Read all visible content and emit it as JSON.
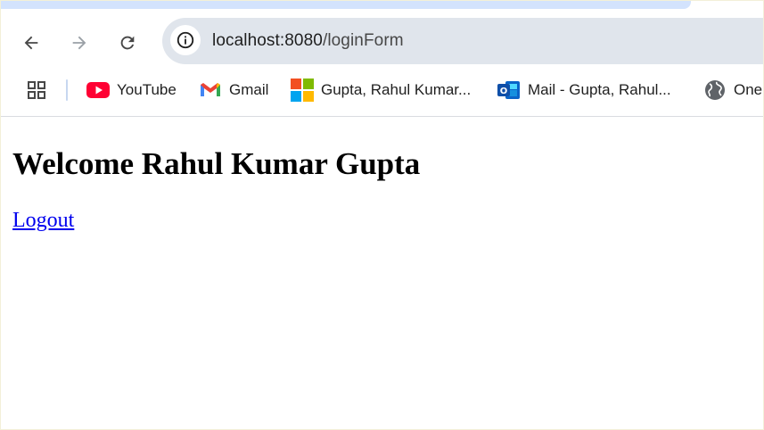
{
  "browser": {
    "address_bar": {
      "host": "localhost:8080",
      "path": "/loginForm"
    },
    "bookmarks": [
      {
        "label": "YouTube",
        "icon": "youtube-icon"
      },
      {
        "label": "Gmail",
        "icon": "gmail-icon"
      },
      {
        "label": "Gupta, Rahul Kumar...",
        "icon": "microsoft-icon"
      },
      {
        "label": "Mail - Gupta, Rahul...",
        "icon": "outlook-icon"
      },
      {
        "label": "One",
        "icon": "globe-icon"
      }
    ],
    "colors": {
      "tab_strip": "#d3e3fd",
      "omnibox": "#e0e5ec",
      "link": "#0000ee"
    }
  },
  "page": {
    "heading": "Welcome Rahul Kumar Gupta",
    "logout_link": "Logout"
  }
}
